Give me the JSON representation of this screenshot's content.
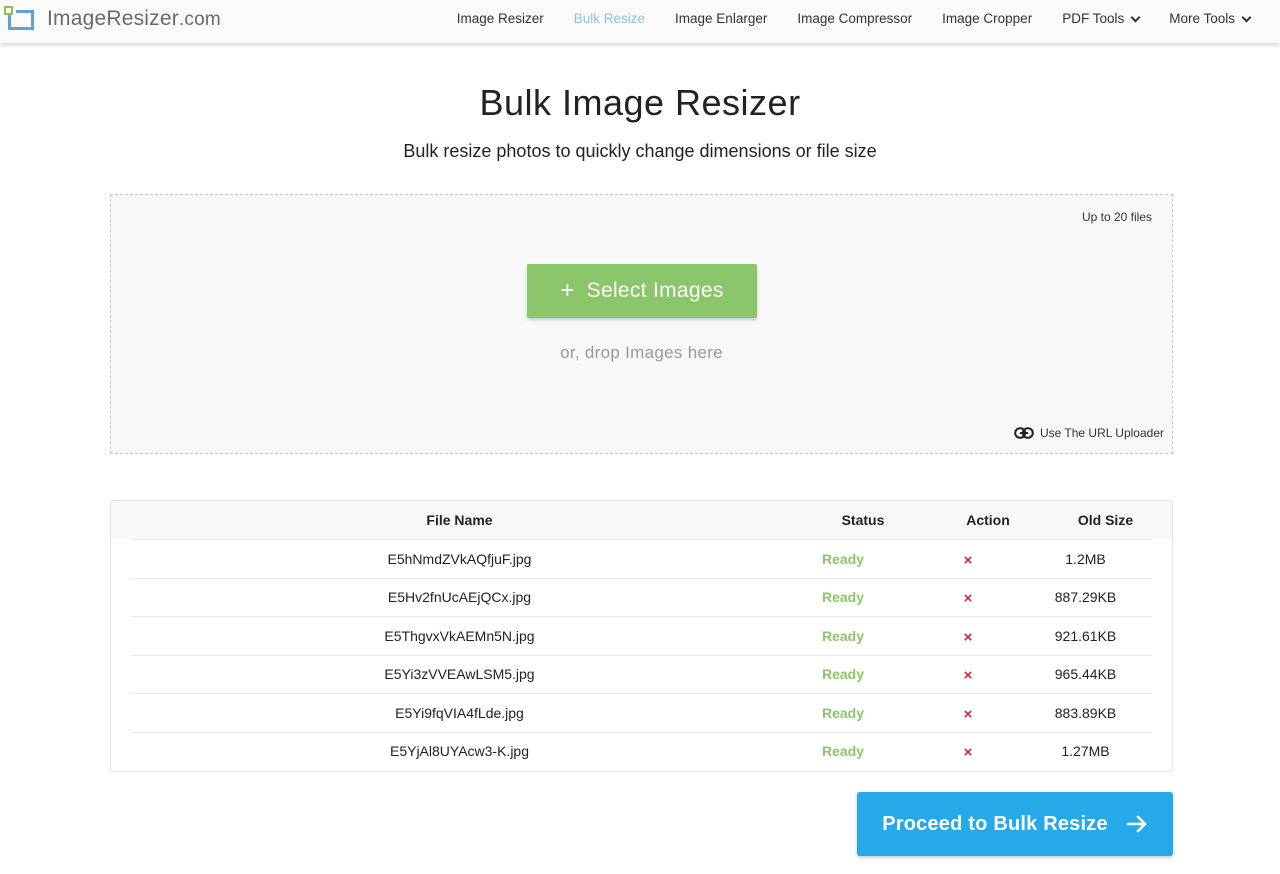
{
  "header": {
    "logo_name": "ImageResizer",
    "logo_tld": ".com",
    "nav": [
      {
        "label": "Image Resizer",
        "active": false,
        "dropdown": false
      },
      {
        "label": "Bulk Resize",
        "active": true,
        "dropdown": false
      },
      {
        "label": "Image Enlarger",
        "active": false,
        "dropdown": false
      },
      {
        "label": "Image Compressor",
        "active": false,
        "dropdown": false
      },
      {
        "label": "Image Cropper",
        "active": false,
        "dropdown": false
      },
      {
        "label": "PDF Tools",
        "active": false,
        "dropdown": true
      },
      {
        "label": "More Tools",
        "active": false,
        "dropdown": true
      }
    ]
  },
  "main": {
    "title": "Bulk Image Resizer",
    "subtitle": "Bulk resize photos to quickly change dimensions or file size"
  },
  "dropzone": {
    "file_limit": "Up to 20 files",
    "select_button": "Select Images",
    "select_icon": "plus-icon",
    "drop_hint": "or, drop Images here",
    "url_uploader": "Use The URL Uploader",
    "url_icon": "link-icon"
  },
  "table": {
    "headers": {
      "file_name": "File Name",
      "status": "Status",
      "action": "Action",
      "old_size": "Old Size"
    },
    "rows": [
      {
        "file_name": "E5hNmdZVkAQfjuF.jpg",
        "status": "Ready",
        "action": "×",
        "old_size": "1.2MB"
      },
      {
        "file_name": "E5Hv2fnUcAEjQCx.jpg",
        "status": "Ready",
        "action": "×",
        "old_size": "887.29KB"
      },
      {
        "file_name": "E5ThgvxVkAEMn5N.jpg",
        "status": "Ready",
        "action": "×",
        "old_size": "921.61KB"
      },
      {
        "file_name": "E5Yi3zVVEAwLSM5.jpg",
        "status": "Ready",
        "action": "×",
        "old_size": "965.44KB"
      },
      {
        "file_name": "E5Yi9fqVIA4fLde.jpg",
        "status": "Ready",
        "action": "×",
        "old_size": "883.89KB"
      },
      {
        "file_name": "E5YjAl8UYAcw3-K.jpg",
        "status": "Ready",
        "action": "×",
        "old_size": "1.27MB"
      }
    ]
  },
  "proceed_button": {
    "label": "Proceed to Bulk Resize",
    "icon": "arrow-right-icon"
  },
  "colors": {
    "accent_green": "#8cc66a",
    "accent_blue": "#25a9e8",
    "active_nav": "#8cc3e2",
    "remove_red": "#d2224a"
  }
}
